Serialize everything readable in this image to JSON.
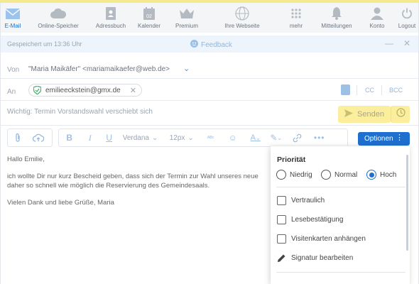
{
  "nav": {
    "items": [
      {
        "label": "E-Mail",
        "icon": "mail-icon"
      },
      {
        "label": "Online-Speicher",
        "icon": "cloud-icon"
      },
      {
        "label": "Adressbuch",
        "icon": "addressbook-icon"
      },
      {
        "label": "Kalender",
        "icon": "calendar-icon",
        "badge": "02"
      },
      {
        "label": "Premium",
        "icon": "crown-icon"
      },
      {
        "label": "Ihre Webseite",
        "icon": "www-icon"
      },
      {
        "label": "mehr",
        "icon": "grid-icon"
      },
      {
        "label": "Mitteilungen",
        "icon": "bell-icon"
      },
      {
        "label": "Konto",
        "icon": "user-icon"
      },
      {
        "label": "Logout",
        "icon": "power-icon"
      }
    ]
  },
  "status": {
    "saved": "Gespeichert um 13:36 Uhr",
    "feedback": "Feedback"
  },
  "compose": {
    "from_label": "Von",
    "from_value": "\"Maria Maikäfer\" <mariamaikaefer@web.de>",
    "to_label": "An",
    "to_recipient": "emilieeckstein@gmx.de",
    "cc": "CC",
    "bcc": "BCC",
    "subject": "Wichtig: Termin Vorstandswahl verschiebt sich",
    "send": "Senden"
  },
  "toolbar": {
    "font": "Verdana",
    "size": "12px",
    "options": "Optionen"
  },
  "body": {
    "greeting": "Hallo Emilie,",
    "line1": "ich wollte Dir nur kurz Bescheid geben, dass sich der Termin zur Wahl unseres neue",
    "line2": "daher so schnell wie möglich die Reservierung des Gemeindesaals.",
    "closing": "Vielen Dank und liebe Grüße, Maria"
  },
  "options_panel": {
    "priority_title": "Priorität",
    "priority_options": [
      "Niedrig",
      "Normal",
      "Hoch"
    ],
    "priority_selected": "Hoch",
    "vertraulich": "Vertraulich",
    "lesebestaetigung": "Lesebestätigung",
    "visitenkarten": "Visitenkarten anhängen",
    "signatur": "Signatur bearbeiten"
  },
  "colors": {
    "accent": "#1f6fd1",
    "send_bg": "#fbee9c",
    "nav_active": "#1c6ec9"
  }
}
